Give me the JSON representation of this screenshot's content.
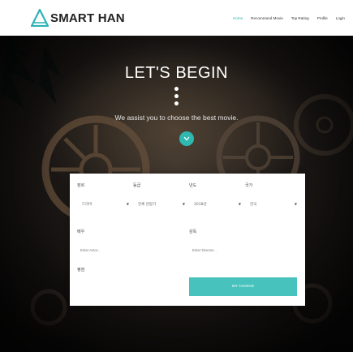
{
  "brand": {
    "name": "SMART HAN",
    "logo_icon": "triangle-logo-icon",
    "accent": "#2fb3b3"
  },
  "nav": {
    "items": [
      {
        "label": "Home",
        "active": true
      },
      {
        "label": "Recommand Movie",
        "active": false
      },
      {
        "label": "Top Rating",
        "active": false
      },
      {
        "label": "Profile",
        "active": false
      },
      {
        "label": "Login",
        "active": false
      }
    ]
  },
  "hero": {
    "title": "LET'S BEGIN",
    "dots": "•\n•\n•",
    "subtitle": "We assist you to choose the best movie.",
    "scroll_icon": "chevron-down-icon"
  },
  "form": {
    "genre": {
      "label": "장르",
      "value": "드라마"
    },
    "rating": {
      "label": "등급",
      "value": "전체 관람가"
    },
    "year": {
      "label": "년도",
      "value": "2018년"
    },
    "country": {
      "label": "국가",
      "value": "한국"
    },
    "actor": {
      "label": "배우",
      "placeholder": "Enter Actor..."
    },
    "director": {
      "label": "감독",
      "placeholder": "Enter Director..."
    },
    "keyword": {
      "label": "평점"
    },
    "submit_label": "MY CHOICE",
    "button_color": "#48c2bc"
  }
}
